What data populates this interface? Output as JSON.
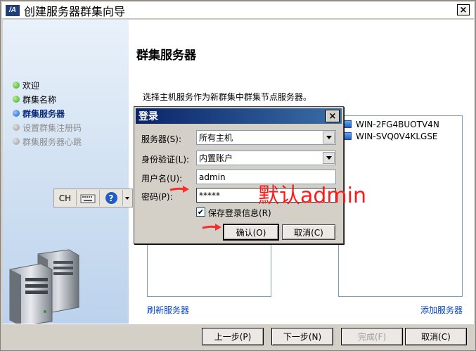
{
  "window": {
    "title": "创建服务器群集向导",
    "app_icon": "/A",
    "close": "×"
  },
  "sidebar": {
    "steps": [
      {
        "label": "欢迎",
        "state": "done"
      },
      {
        "label": "群集名称",
        "state": "done"
      },
      {
        "label": "群集服务器",
        "state": "current"
      },
      {
        "label": "设置群集注册码",
        "state": "disabled"
      },
      {
        "label": "群集服务器心跳",
        "state": "disabled"
      }
    ]
  },
  "main": {
    "title": "群集服务器",
    "instruction": "选择主机服务作为新群集中群集节点服务器。",
    "left_list": [],
    "right_list": [
      "WIN-2FG4BUOTV4N",
      "WIN-SVQ0V4KLGSE"
    ],
    "refresh_link": "刷新服务器",
    "add_link": "添加服务器"
  },
  "footer": {
    "prev": "上一步(P)",
    "next": "下一步(N)",
    "finish": "完成(F)",
    "cancel": "取消(C)"
  },
  "ime": {
    "lang": "CH",
    "help": "?"
  },
  "login": {
    "title": "登录",
    "server_label": "服务器(S):",
    "server_value": "所有主机",
    "auth_label": "身份验证(L):",
    "auth_value": "内置账户",
    "user_label": "用户名(U):",
    "user_value": "admin",
    "pass_label": "密码(P):",
    "pass_value": "*****",
    "save_label": "保存登录信息(R)",
    "save_checked": true,
    "ok": "确认(O)",
    "cancel": "取消(C)"
  },
  "annotation": {
    "text": "默认admin",
    "color": "#ff1a1a"
  }
}
